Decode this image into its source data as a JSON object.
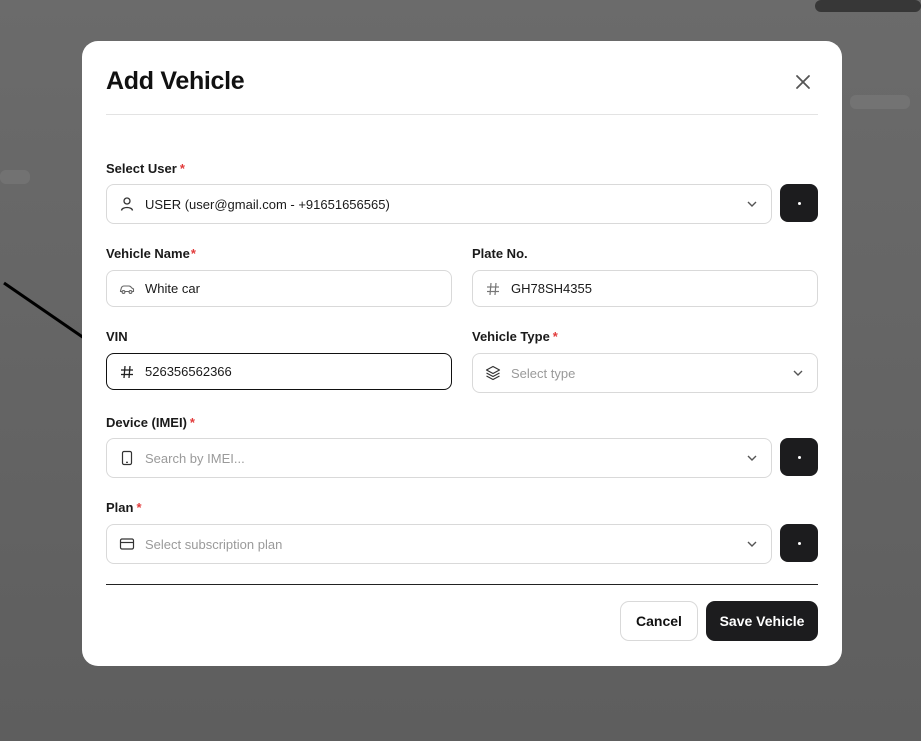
{
  "modal": {
    "title": "Add Vehicle",
    "close_icon": "close-icon"
  },
  "form": {
    "select_user": {
      "label": "Select User",
      "required_mark": "*",
      "value": "USER (user@gmail.com - +91651656565)",
      "icon": "user-icon"
    },
    "vehicle_name": {
      "label": "Vehicle Name",
      "required_mark": "*",
      "value": "White car",
      "icon": "car-icon"
    },
    "plate_no": {
      "label": "Plate No.",
      "value": "GH78SH4355",
      "icon": "hash-icon"
    },
    "vin": {
      "label": "VIN",
      "value": "526356562366",
      "icon": "hash-icon"
    },
    "vehicle_type": {
      "label": "Vehicle Type",
      "required_mark": "*",
      "placeholder": "Select type",
      "icon": "layers-icon"
    },
    "device": {
      "label": "Device (IMEI)",
      "required_mark": "*",
      "placeholder": "Search by IMEI...",
      "icon": "phone-icon"
    },
    "plan": {
      "label": "Plan",
      "required_mark": "*",
      "placeholder": "Select subscription plan",
      "icon": "credit-card-icon"
    }
  },
  "actions": {
    "cancel_label": "Cancel",
    "save_label": "Save Vehicle"
  },
  "colors": {
    "primary": "#1c1c1e",
    "required": "#e23b3b",
    "overlay": "#6b6b6b"
  }
}
